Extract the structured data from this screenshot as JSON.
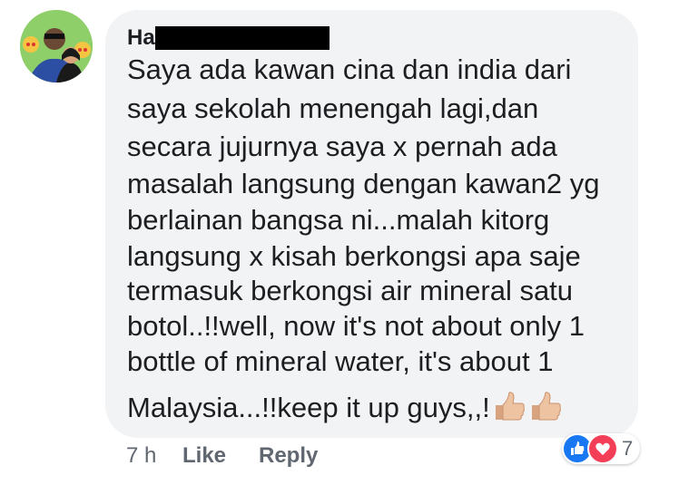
{
  "comment": {
    "author_visible": "Ha",
    "lines": [
      "Saya ada kawan cina dan india dari",
      "saya sekolah menengah lagi,dan",
      "secara jujurnya saya x pernah ada",
      "masalah langsung dengan kawan2 yg",
      "berlainan bangsa ni...malah kitorg",
      "langsung x kisah berkongsi apa saje",
      "termasuk berkongsi air mineral satu",
      "botol..!!well, now it's not about only 1",
      "bottle of mineral water, it's about 1",
      "Malaysia...!!keep it up guys,,!"
    ],
    "emojis": [
      "thumbs-up-icon",
      "thumbs-up-icon"
    ]
  },
  "actions": {
    "time": "7 h",
    "like": "Like",
    "reply": "Reply"
  },
  "reactions": {
    "types": [
      "like",
      "love"
    ],
    "count": "7"
  },
  "colors": {
    "bubble": "#f2f3f5",
    "text": "#1c1e21",
    "meta": "#606770",
    "like_blue": "#1877f2",
    "love_red": "#f33e58"
  }
}
